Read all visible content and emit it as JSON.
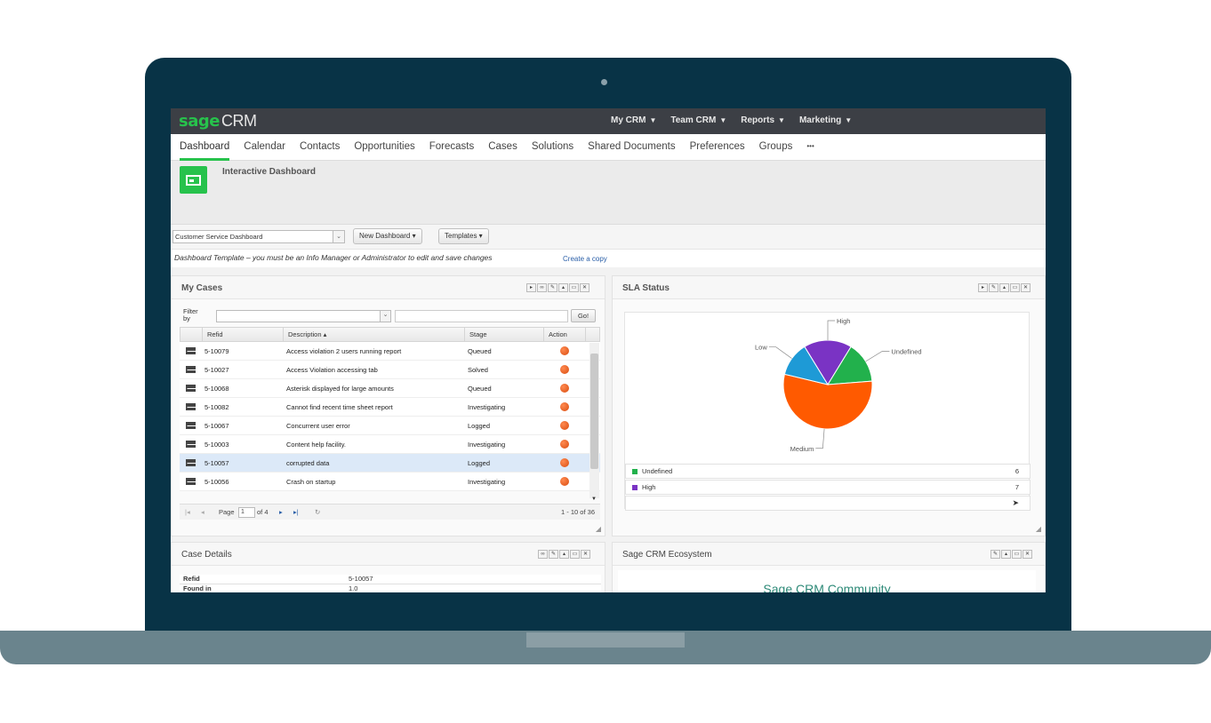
{
  "app": {
    "logo_sage": "sage",
    "logo_crm": "CRM",
    "top_menu": [
      "My CRM",
      "Team CRM",
      "Reports",
      "Marketing"
    ]
  },
  "tabs": [
    "Dashboard",
    "Calendar",
    "Contacts",
    "Opportunities",
    "Forecasts",
    "Cases",
    "Solutions",
    "Shared Documents",
    "Preferences",
    "Groups",
    "•••"
  ],
  "header": {
    "title": "Interactive Dashboard"
  },
  "toolbar": {
    "dashboard_select": "Customer Service Dashboard",
    "new_dashboard": "New Dashboard ▾",
    "templates": "Templates ▾"
  },
  "notice": {
    "message": "Dashboard Template – you must be an Info Manager or Administrator to edit and save changes",
    "create_copy": "Create a copy"
  },
  "my_cases": {
    "title": "My Cases",
    "filter_label": "Filter by",
    "go_label": "Go!",
    "columns": [
      "Refid",
      "Description ▴",
      "Stage",
      "Action"
    ],
    "rows": [
      {
        "refid": "5-10079",
        "description": "Access violation 2 users running report",
        "stage": "Queued"
      },
      {
        "refid": "5-10027",
        "description": "Access Violation accessing tab",
        "stage": "Solved"
      },
      {
        "refid": "5-10068",
        "description": "Asterisk displayed for large amounts",
        "stage": "Queued"
      },
      {
        "refid": "5-10082",
        "description": "Cannot find recent time sheet report",
        "stage": "Investigating"
      },
      {
        "refid": "5-10067",
        "description": "Concurrent user error",
        "stage": "Logged"
      },
      {
        "refid": "5-10003",
        "description": "Content help facility.",
        "stage": "Investigating"
      },
      {
        "refid": "5-10057",
        "description": "corrupted data",
        "stage": "Logged"
      },
      {
        "refid": "5-10056",
        "description": "Crash on startup",
        "stage": "Investigating"
      }
    ],
    "pager": {
      "page_label": "Page",
      "page_value": "1",
      "of_label": "of 4",
      "range": "1 - 10 of 36"
    }
  },
  "sla": {
    "title": "SLA Status",
    "slices": [
      {
        "name": "High",
        "color": "#7a33c4",
        "value": 7
      },
      {
        "name": "Undefined",
        "color": "#22b14c",
        "value": 6
      },
      {
        "name": "Medium",
        "color": "#ff5a00",
        "value": 22
      },
      {
        "name": "Low",
        "color": "#1e9ad6",
        "value": 5
      }
    ],
    "legend": [
      {
        "name": "Undefined",
        "value": "6",
        "color": "#22b14c"
      },
      {
        "name": "High",
        "value": "7",
        "color": "#7a33c4"
      }
    ],
    "legend_more": "➤"
  },
  "case_details": {
    "title": "Case Details",
    "fields": [
      {
        "key": "Refid",
        "value": "5-10057"
      },
      {
        "key": "Found in",
        "value": "1.0"
      }
    ]
  },
  "ecosystem": {
    "title": "Sage CRM Ecosystem",
    "heading": "Sage CRM Community"
  }
}
